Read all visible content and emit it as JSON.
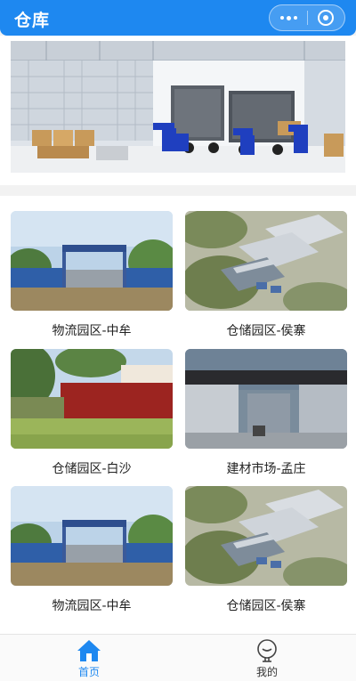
{
  "header": {
    "title": "仓库",
    "menu_icon": "more-dots-icon",
    "close_icon": "target-close-icon"
  },
  "banner": {
    "image": "warehouse-dock-illustration"
  },
  "warehouses": [
    {
      "name": "物流园区-中牟",
      "image": "gate-construction-photo"
    },
    {
      "name": "仓储园区-侯寨",
      "image": "aerial-industrial-park-render"
    },
    {
      "name": "仓储园区-白沙",
      "image": "red-wall-sign-photo"
    },
    {
      "name": "建材市场-孟庄",
      "image": "building-materials-market-gate-render"
    },
    {
      "name": "物流园区-中牟",
      "image": "gate-construction-photo"
    },
    {
      "name": "仓储园区-侯寨",
      "image": "aerial-industrial-park-render"
    }
  ],
  "tabbar": {
    "items": [
      {
        "label": "首页",
        "icon": "home-icon",
        "active": true
      },
      {
        "label": "我的",
        "icon": "user-icon",
        "active": false
      }
    ],
    "active_color": "#1e88f0",
    "inactive_color": "#333333"
  },
  "colors": {
    "primary": "#1e88f0"
  }
}
